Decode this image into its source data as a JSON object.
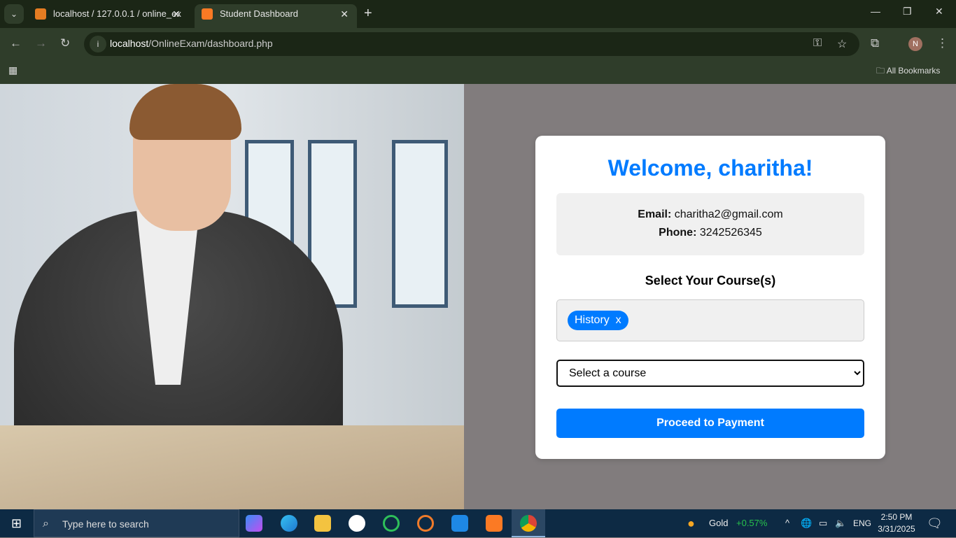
{
  "browser": {
    "tabs": [
      {
        "title": "localhost / 127.0.0.1 / online_ex",
        "active": false
      },
      {
        "title": "Student Dashboard",
        "active": true
      }
    ],
    "url_host": "localhost",
    "url_path": "/OnlineExam/dashboard.php",
    "bookmarks_label": "All Bookmarks",
    "profile_initial": "N"
  },
  "dashboard": {
    "welcome": "Welcome, charitha!",
    "email_label": "Email:",
    "email": "charitha2@gmail.com",
    "phone_label": "Phone:",
    "phone": "3242526345",
    "select_heading": "Select Your Course(s)",
    "selected_courses": [
      {
        "name": "History",
        "remove": "x"
      }
    ],
    "course_select_value": "Select a course",
    "proceed_button": "Proceed to Payment",
    "accent": "#007bff"
  },
  "taskbar": {
    "search_placeholder": "Type here to search",
    "widget_name": "Gold",
    "widget_change": "+0.57%",
    "lang": "ENG",
    "time": "2:50 PM",
    "date": "3/31/2025"
  }
}
